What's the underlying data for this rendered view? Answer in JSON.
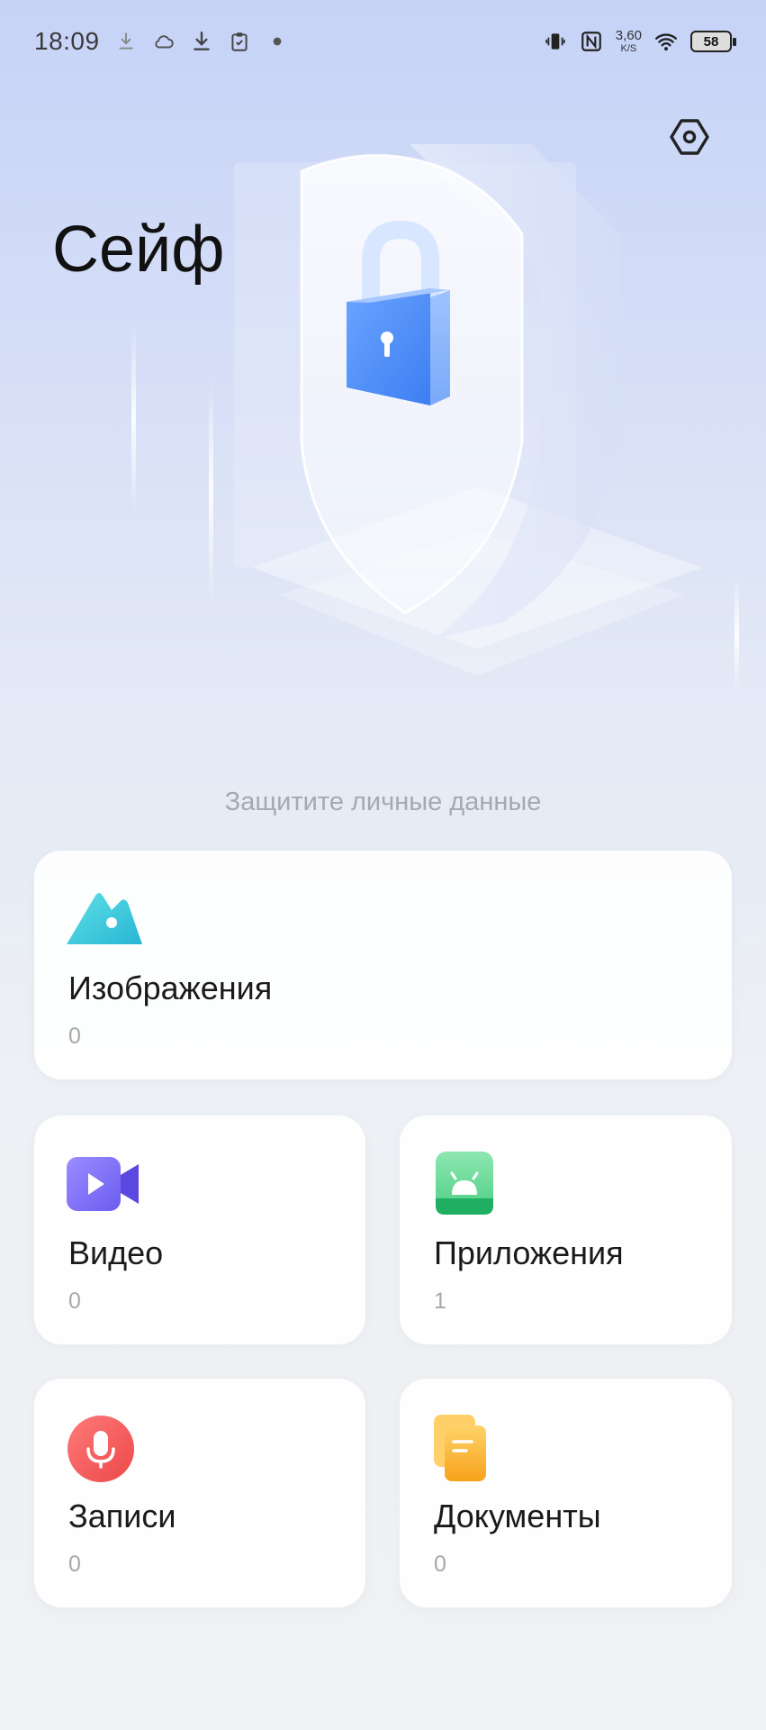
{
  "status_bar": {
    "time": "18:09",
    "net_speed_value": "3,60",
    "net_speed_unit": "K/S",
    "battery": "58",
    "left_icons": [
      "download-small-icon",
      "cloud-icon",
      "download-icon",
      "clipboard-check-icon",
      "dot-icon"
    ],
    "right_icons": [
      "vibrate-icon",
      "nfc-icon",
      "wifi-icon",
      "battery-icon"
    ]
  },
  "header": {
    "title": "Сейф",
    "settings_icon": "settings-icon"
  },
  "hero": {
    "subtitle": "Защитите личные данные",
    "illustration": "shield-lock-illustration"
  },
  "categories": {
    "images": {
      "label": "Изображения",
      "count": "0",
      "icon": "image-icon",
      "color": "#3cc8d8"
    },
    "video": {
      "label": "Видео",
      "count": "0",
      "icon": "video-icon",
      "color": "#7b6ef6"
    },
    "apps": {
      "label": "Приложения",
      "count": "1",
      "icon": "android-icon",
      "color": "#3ec87a"
    },
    "records": {
      "label": "Записи",
      "count": "0",
      "icon": "microphone-icon",
      "color": "#f25b5b"
    },
    "documents": {
      "label": "Документы",
      "count": "0",
      "icon": "document-icon",
      "color": "#f7b733"
    }
  }
}
